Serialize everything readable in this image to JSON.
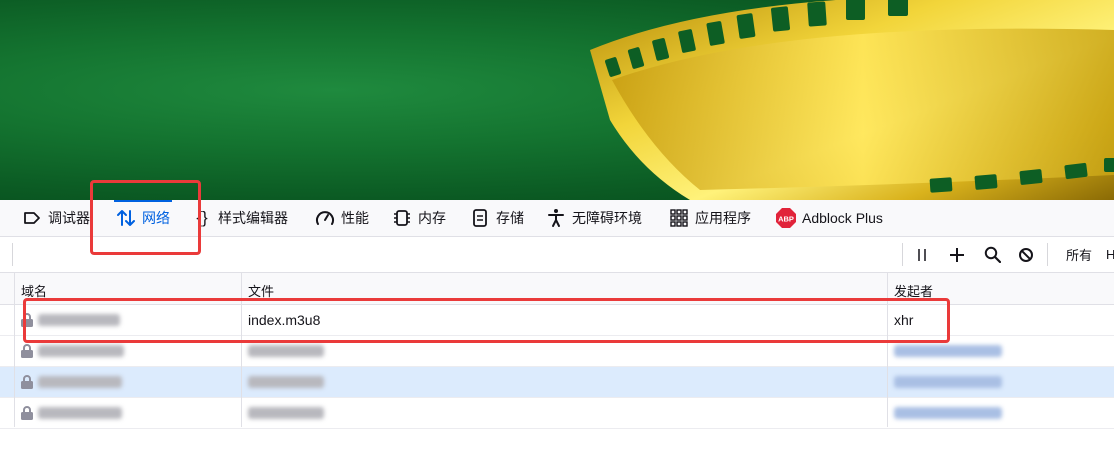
{
  "devtools_tabs": [
    {
      "label": "调试器",
      "icon": "debugger-icon",
      "active": false
    },
    {
      "label": "网络",
      "icon": "network-updown-arrows-icon",
      "active": true
    },
    {
      "label": "样式编辑器",
      "icon": "style-editor-braces-icon",
      "active": false
    },
    {
      "label": "性能",
      "icon": "performance-gauge-icon",
      "active": false
    },
    {
      "label": "内存",
      "icon": "memory-chip-icon",
      "active": false
    },
    {
      "label": "存储",
      "icon": "storage-icon",
      "active": false
    },
    {
      "label": "无障碍环境",
      "icon": "accessibility-icon",
      "active": false
    },
    {
      "label": "应用程序",
      "icon": "application-grid-icon",
      "active": false
    },
    {
      "label": "Adblock Plus",
      "icon": "abp-icon",
      "active": false
    }
  ],
  "network_toolbar": {
    "pause_icon": "pause-icon",
    "add_icon": "plus-icon",
    "search_icon": "search-icon",
    "block_icon": "block-icon",
    "filter_all_label": "所有"
  },
  "table": {
    "headers": {
      "domain": "域名",
      "file": "文件",
      "initiator": "发起者"
    },
    "rows": [
      {
        "file": "index.m3u8",
        "initiator": "xhr",
        "selected": false,
        "redacted": false
      },
      {
        "file": "",
        "initiator": "",
        "selected": false,
        "redacted": true
      },
      {
        "file": "",
        "initiator": "",
        "selected": true,
        "redacted": true
      },
      {
        "file": "",
        "initiator": "",
        "selected": false,
        "redacted": true
      }
    ]
  },
  "colors": {
    "accent": "#0061e0",
    "annotation_red": "#ea3a3a",
    "selected_row": "#dcebfd",
    "video_green": "#147430",
    "film_gold": "#e0c020"
  }
}
